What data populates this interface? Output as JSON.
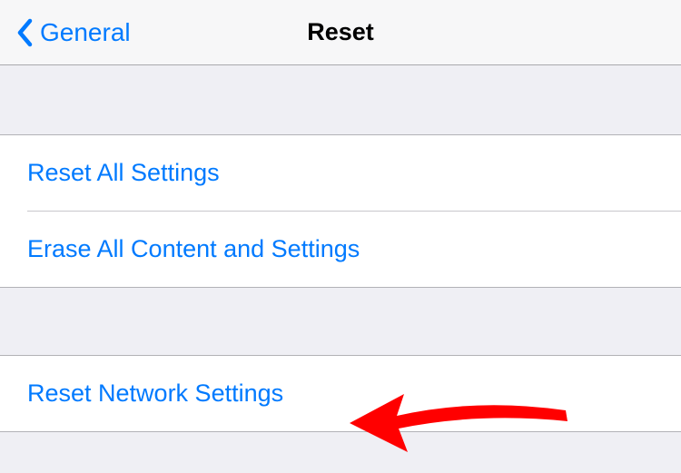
{
  "nav": {
    "back_label": "General",
    "title": "Reset"
  },
  "sections": {
    "group1": {
      "item1": "Reset All Settings",
      "item2": "Erase All Content and Settings"
    },
    "group2": {
      "item1": "Reset Network Settings"
    }
  },
  "colors": {
    "accent": "#007aff",
    "background": "#efeff4",
    "separator": "#c8c7cc",
    "annotation": "#ff0000"
  }
}
